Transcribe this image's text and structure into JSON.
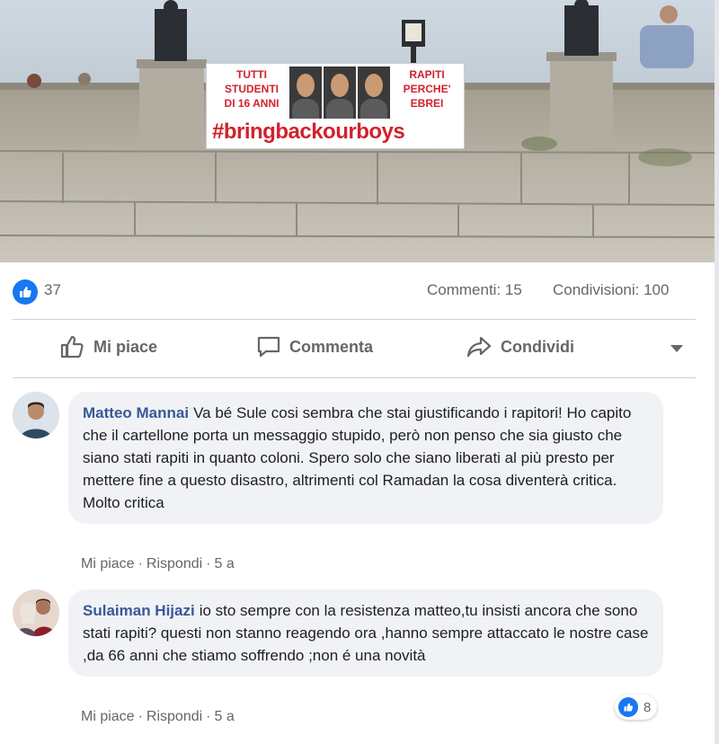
{
  "post": {
    "banner": {
      "left_text": "TUTTI\nSTUDENTI\nDI 16 ANNI",
      "right_text": "RAPITI\nPERCHE'\nEBREI",
      "hashtag": "#bringbackourboys"
    }
  },
  "stats": {
    "likes": "37",
    "comments": "Commenti: 15",
    "shares": "Condivisioni: 100"
  },
  "actions": {
    "like": "Mi piace",
    "comment": "Commenta",
    "share": "Condividi"
  },
  "comments": [
    {
      "author": "Matteo Mannai",
      "text": "Va bé Sule cosi sembra che stai giustificando i rapitori! Ho capito che il cartellone porta un messaggio stupido, però non penso che sia giusto che siano stati rapiti in quanto coloni. Spero solo che siano liberati al più presto per mettere fine a questo disastro, altrimenti col Ramadan la cosa diventerà critica. Molto critica",
      "like_label": "Mi piace",
      "reply_label": "Rispondi",
      "time": "5 a"
    },
    {
      "author": "Sulaiman Hijazi",
      "text": "io sto sempre con la resistenza matteo,tu insisti ancora che sono stati rapiti? questi non stanno reagendo ora ,hanno sempre attaccato le nostre case ,da 66 anni che stiamo soffrendo ;non é una novità",
      "like_label": "Mi piace",
      "reply_label": "Rispondi",
      "time": "5 a",
      "reactions": "8"
    }
  ],
  "colors": {
    "accent": "#1877f2",
    "author": "#385898",
    "muted": "#65676b",
    "bubble": "#f0f2f5",
    "banner_text": "#d1222e"
  }
}
